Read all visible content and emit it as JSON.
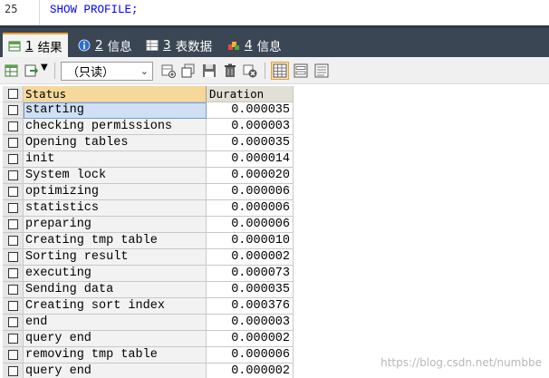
{
  "editor": {
    "line_number": "25",
    "code": "SHOW PROFILE;"
  },
  "tabs": [
    {
      "num": "1",
      "label": "结果",
      "icon": "result-table-icon",
      "active": true
    },
    {
      "num": "2",
      "label": "信息",
      "icon": "info-icon",
      "active": false
    },
    {
      "num": "3",
      "label": "表数据",
      "icon": "table-data-icon",
      "active": false
    },
    {
      "num": "4",
      "label": "信息",
      "icon": "info-multi-icon",
      "active": false
    }
  ],
  "toolbar": {
    "mode_value": "（只读）",
    "buttons": [
      "export-grid-icon",
      "export-dropdown-icon",
      "add-row-icon",
      "duplicate-row-icon",
      "save-icon",
      "delete-icon",
      "cancel-icon",
      "grid-view-icon",
      "form-view-icon",
      "text-view-icon"
    ]
  },
  "grid": {
    "columns": [
      "Status",
      "Duration"
    ],
    "rows": [
      {
        "status": "starting",
        "duration": "0.000035"
      },
      {
        "status": "checking permissions",
        "duration": "0.000003"
      },
      {
        "status": "Opening tables",
        "duration": "0.000035"
      },
      {
        "status": "init",
        "duration": "0.000014"
      },
      {
        "status": "System lock",
        "duration": "0.000020"
      },
      {
        "status": "optimizing",
        "duration": "0.000006"
      },
      {
        "status": "statistics",
        "duration": "0.000006"
      },
      {
        "status": "preparing",
        "duration": "0.000006"
      },
      {
        "status": "Creating tmp table",
        "duration": "0.000010"
      },
      {
        "status": "Sorting result",
        "duration": "0.000002"
      },
      {
        "status": "executing",
        "duration": "0.000073"
      },
      {
        "status": "Sending data",
        "duration": "0.000035"
      },
      {
        "status": "Creating sort index",
        "duration": "0.000376"
      },
      {
        "status": "end",
        "duration": "0.000003"
      },
      {
        "status": "query end",
        "duration": "0.000002"
      },
      {
        "status": "removing tmp table",
        "duration": "0.000006"
      },
      {
        "status": "query end",
        "duration": "0.000002"
      }
    ]
  },
  "watermark": "https://blog.csdn.net/numbbe",
  "colors": {
    "tabbar_bg": "#3a4654",
    "active_tab_accent": "#f0a030",
    "header_sort_bg": "#f6d89a",
    "sql_keyword": "#0000ff"
  }
}
